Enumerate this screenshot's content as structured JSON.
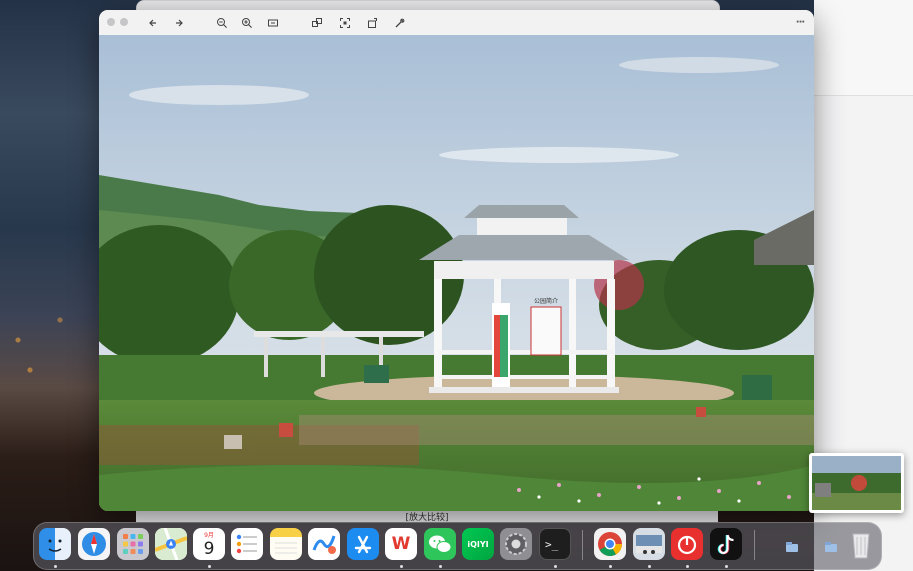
{
  "desktop": {
    "background_window_caption": "[放大比较]"
  },
  "viewer": {
    "toolbar": {
      "close": "close",
      "minimize": "minimize",
      "back_icon": "arrow-left-icon",
      "forward_icon": "arrow-right-icon",
      "zoom_out_icon": "zoom-out-icon",
      "zoom_in_icon": "zoom-in-icon",
      "fit_icon": "fit-to-window-icon",
      "share_icon": "share-icon",
      "crop_icon": "crop-icon",
      "rotate_icon": "rotate-icon",
      "markup_icon": "markup-icon",
      "more_label": "···"
    },
    "photo": {
      "sign_text": "公园简介"
    }
  },
  "dock": {
    "calendar_month": "9月",
    "calendar_day": "9",
    "items": [
      {
        "name": "Finder"
      },
      {
        "name": "Safari"
      },
      {
        "name": "Launchpad"
      },
      {
        "name": "Maps"
      },
      {
        "name": "Calendar"
      },
      {
        "name": "Reminders"
      },
      {
        "name": "Notes"
      },
      {
        "name": "Freeform"
      },
      {
        "name": "App Store"
      },
      {
        "name": "WPS Office"
      },
      {
        "name": "WeChat"
      },
      {
        "name": "iQIYI"
      },
      {
        "name": "System Settings"
      },
      {
        "name": "Terminal"
      },
      {
        "name": "Chrome"
      },
      {
        "name": "Preview"
      },
      {
        "name": "NetEase Music"
      },
      {
        "name": "TikTok"
      },
      {
        "name": "Downloads"
      },
      {
        "name": "Documents"
      },
      {
        "name": "Trash"
      }
    ],
    "wps_label": "W",
    "iqiyi_label": "iQIYI",
    "terminal_label": ">_"
  }
}
